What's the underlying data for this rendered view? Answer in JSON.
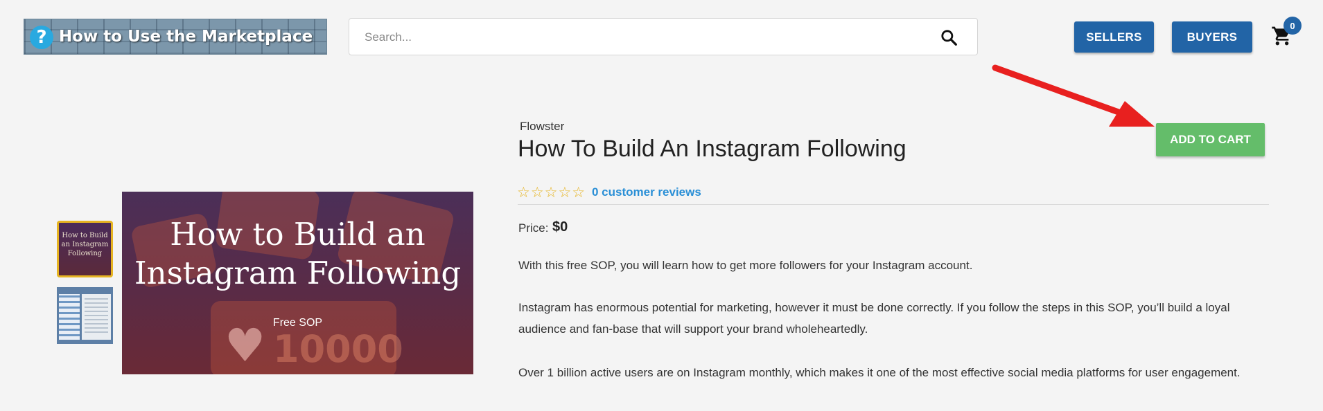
{
  "header": {
    "logo_text": "How to Use the Marketplace",
    "search_placeholder": "Search...",
    "sellers_label": "SELLERS",
    "buyers_label": "BUYERS",
    "cart_count": "0"
  },
  "product": {
    "brand": "Flowster",
    "title": "How To Build An Instagram Following",
    "rating_stars": "☆☆☆☆☆",
    "reviews_link": "0 customer reviews",
    "price_label": "Price:",
    "price": "$0",
    "add_to_cart_label": "ADD TO CART",
    "description": [
      "With this free SOP, you will learn how to get more followers for your Instagram account.",
      "Instagram has enormous potential for marketing, however it must be done correctly. If you follow the steps in this SOP, you’ll build a loyal audience and fan-base that will support your brand wholeheartedly.",
      "Over 1 billion active users are on Instagram monthly, which makes it one of the most effective social media platforms for user engagement."
    ]
  },
  "gallery": {
    "main_image_title": "How to Build an Instagram Following",
    "main_image_subtitle": "Free SOP",
    "main_image_bg_number": "10000",
    "thumb1_text": "How to Build an Instagram Following"
  },
  "colors": {
    "accent_blue": "#2264a6",
    "add_to_cart_green": "#64bd6a",
    "link_blue": "#2a8fd6",
    "star_gold": "#e6b422",
    "annotation_arrow": "#e8201f"
  }
}
